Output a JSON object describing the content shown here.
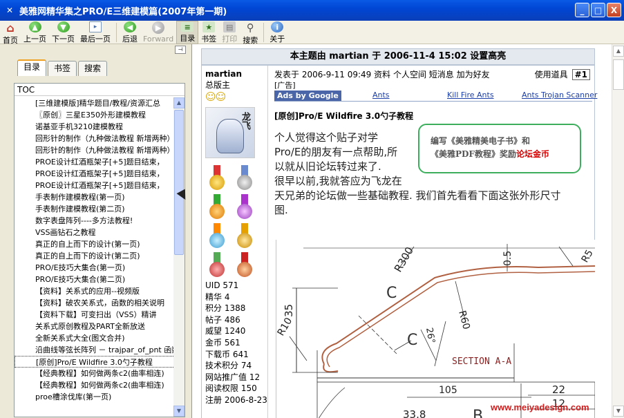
{
  "window": {
    "title": "美雅网精华集之PRO/E三维建模篇(2007年第一期)",
    "controls": [
      "_",
      "□",
      "X"
    ]
  },
  "toolbar": {
    "buttons": [
      {
        "label": "首页",
        "icon": "home-icon",
        "enabled": true
      },
      {
        "label": "上一页",
        "icon": "arrow-up-icon",
        "enabled": true
      },
      {
        "label": "下一页",
        "icon": "arrow-down-icon",
        "enabled": true
      },
      {
        "label": "最后一页",
        "icon": "last-page-icon",
        "enabled": true
      },
      {
        "label": "后退",
        "icon": "back-icon",
        "enabled": true
      },
      {
        "label": "Forward",
        "icon": "forward-icon",
        "enabled": false
      },
      {
        "label": "目录",
        "icon": "toc-icon",
        "enabled": true,
        "pressed": true
      },
      {
        "label": "书签",
        "icon": "bookmark-icon",
        "enabled": true
      },
      {
        "label": "打印",
        "icon": "print-icon",
        "enabled": false
      },
      {
        "label": "搜索",
        "icon": "search-icon",
        "enabled": true
      },
      {
        "label": "关于",
        "icon": "info-icon",
        "enabled": true
      }
    ]
  },
  "sidebar": {
    "tabs": [
      "目录",
      "书签",
      "搜索"
    ],
    "active_tab": "目录",
    "toc_header": "TOC",
    "items": [
      "[三维建模版]精华题目/教程/资源汇总",
      "〖原创〗三星E350外形建模教程",
      "诺基亚手机3210建模教程",
      "回形针的制作（九种做法教程 新增两种）",
      "回形针的制作（九种做法教程 新增两种）",
      "PROE设计红酒瓶架子[+5]题目结束，",
      "PROE设计红酒瓶架子[+5]题目结束，",
      "PROE设计红酒瓶架子[+5]题目结束，",
      "手表制作建模教程(第一页)",
      "手表制作建模教程(第二页)",
      "数字表盘阵列----多方法教程!",
      "VSS画钻石之教程",
      "真正的自上而下的设计(第一页)",
      "真正的自上而下的设计(第二页)",
      "PRO/E技巧大集合(第一页)",
      "PRO/E技巧大集合(第二页)",
      "【资料】关系式的应用--视频版",
      "【资料】破农关系式，函数的相关说明",
      "【资料下载】可变扫出（VSS）精讲",
      "关系式原创教程及PART全新放送",
      "全新关系式大全(图文合并)",
      "沿曲线等弦长阵列 － trajpar_of_pnt 函数",
      "[原创]Pro/E Wildfire 3.0勺子教程",
      "【经典教程】如何做两条c2(曲率相连)",
      "【经典教程】如何做两条c2(曲率相连)",
      "proe槽涂伐库(第一页)"
    ],
    "selected_index": 22
  },
  "topic": {
    "header": "本主题由 martian 于 2006-11-4 15:02 设置高亮"
  },
  "post": {
    "author": {
      "name": "martian",
      "group": "总版主",
      "stats": [
        "UID 571",
        "精华 4",
        "积分 1388",
        "帖子 486",
        "威望 1240",
        "金币 561",
        "下载币 641",
        "技术积分 74",
        "网站推广值 12",
        "阅读权限 150",
        "注册 2006-8-23"
      ]
    },
    "meta": "发表于 2006-9-11 09:49  资料  个人空间  短消息  加为好友",
    "tools_label": "使用道具",
    "floor": "#1",
    "ad_label": "[广告]",
    "ads_by": "Ads by Google",
    "ad_links": [
      "Ants",
      "Kill Fire Ants",
      "Ants Trojan Scanner"
    ],
    "subject": "[原创]Pro/E Wildfire 3.0勺子教程",
    "body_lines": [
      "个人觉得这个贴子对学",
      "Pro/E的朋友有一点帮助,所",
      "以就从旧论坛转过来了.",
      "很早以前,我就答应为飞龙在",
      "天兄弟的论坛做一些基础教程. 我们首先看看下面这张外形尺寸",
      "图."
    ],
    "promo": {
      "line1": "编写《美雅精美电子书》和",
      "line2a": "《美雅PDF教程》奖励",
      "line2b": "论坛金币"
    },
    "drawing": {
      "dims": [
        "R300",
        "0.5",
        "R5",
        "C",
        "35",
        "R60",
        "C",
        "26°",
        "R10",
        "SECTION A-A",
        "105",
        "B",
        "22",
        "12",
        "33.8"
      ]
    }
  },
  "watermark": "www.meiyadesign.com"
}
